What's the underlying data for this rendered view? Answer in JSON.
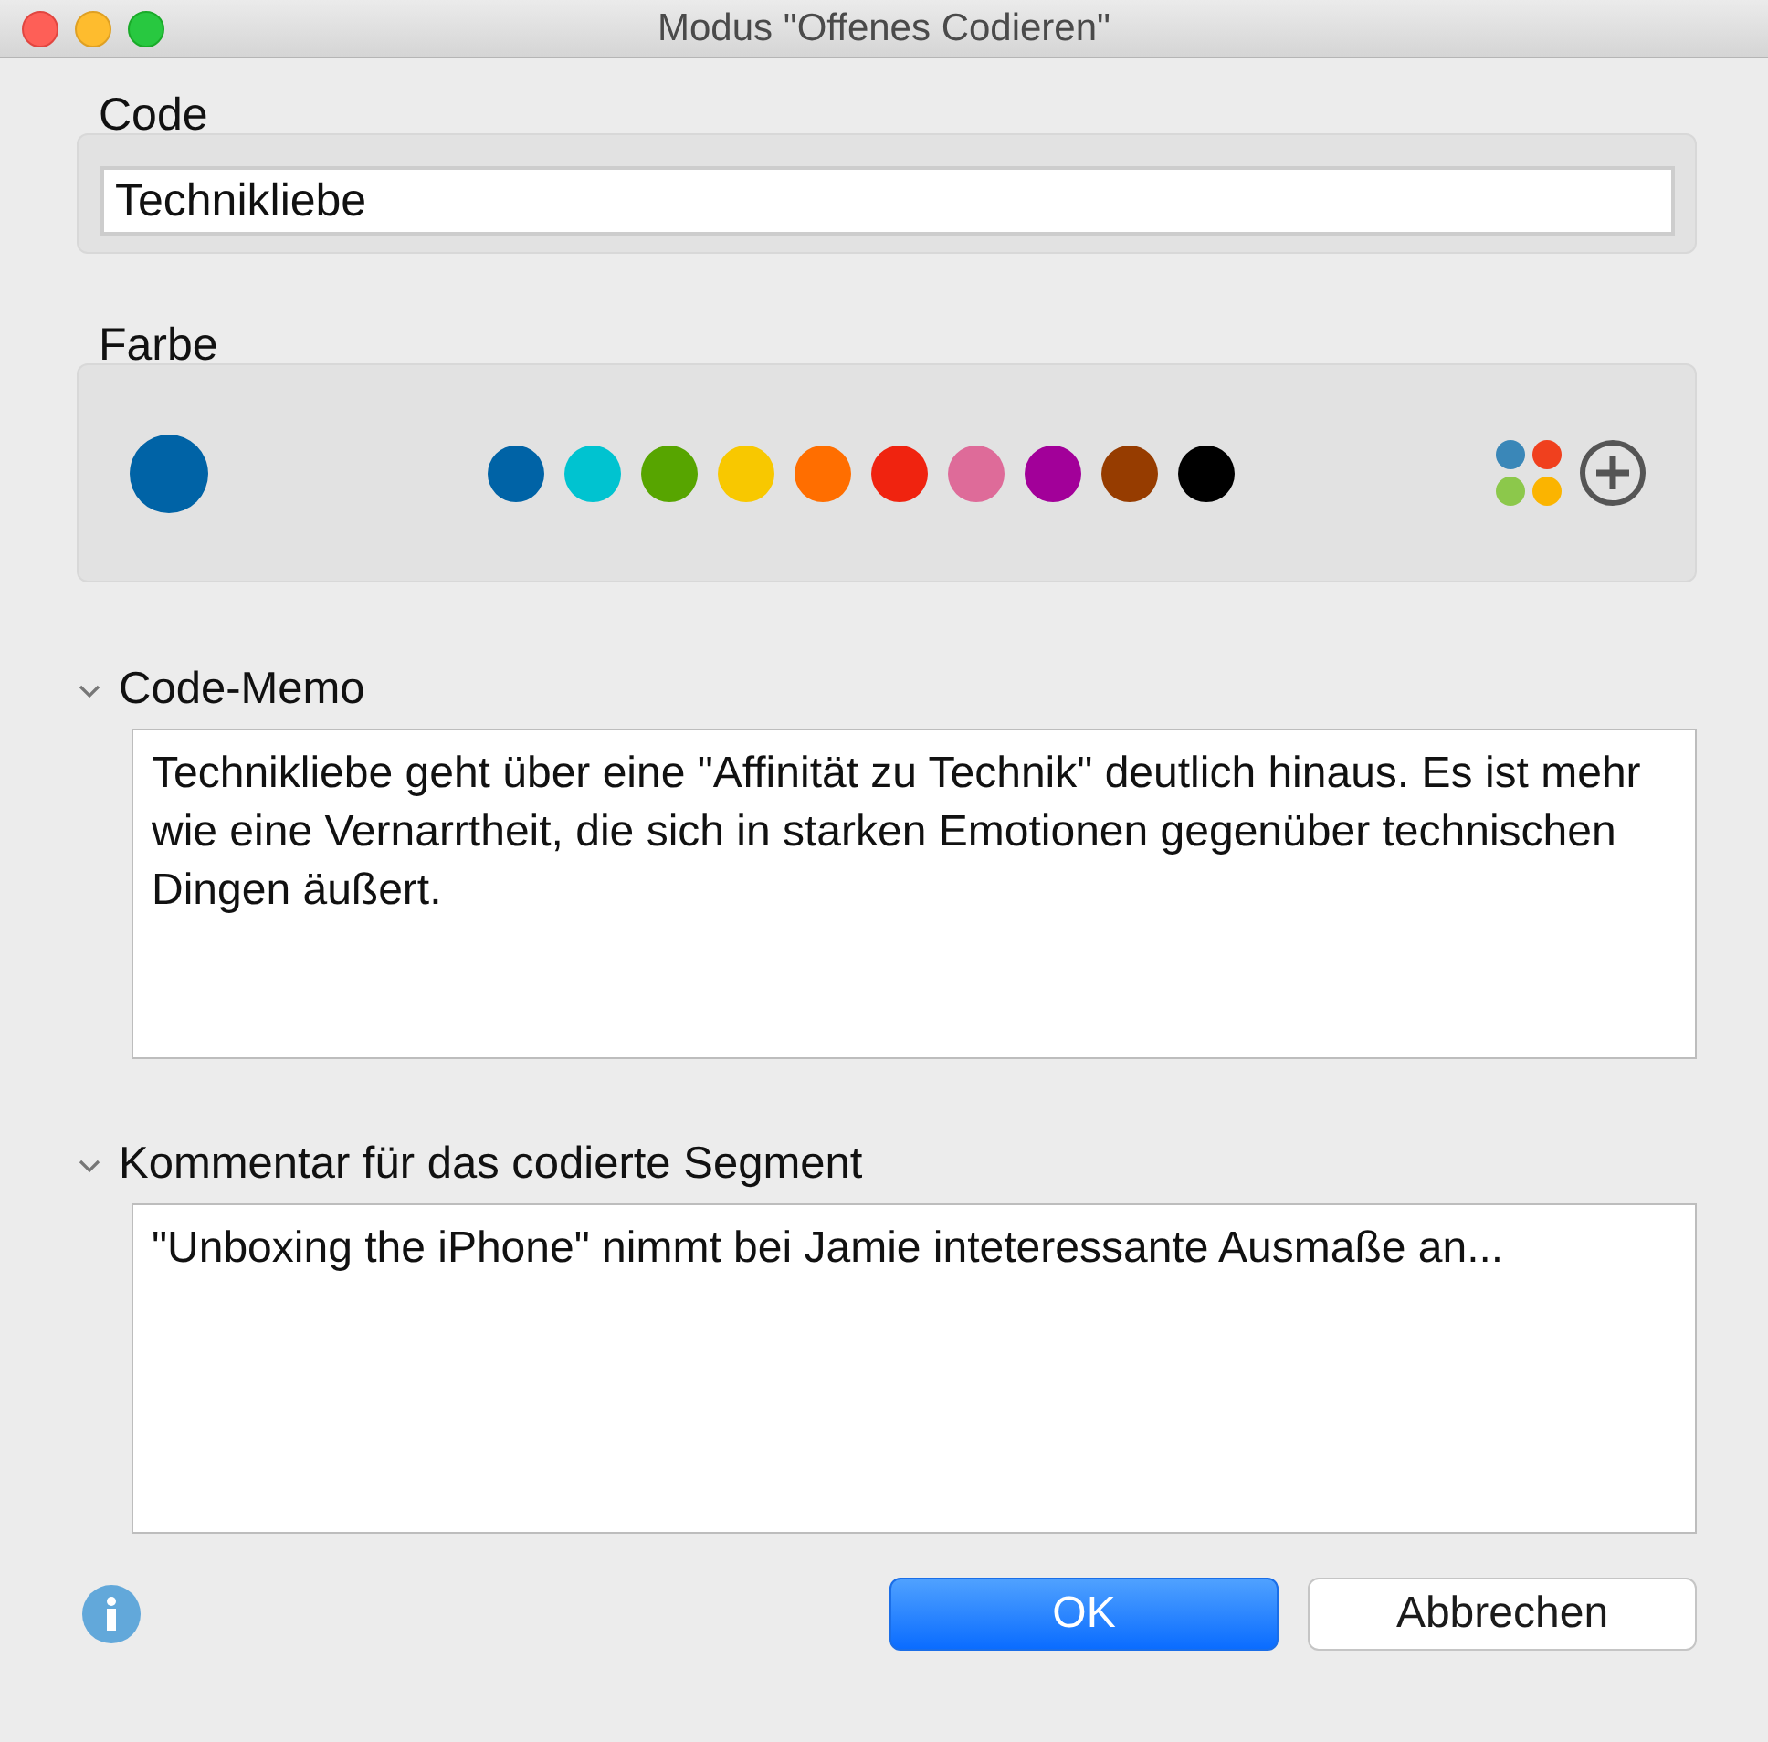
{
  "window": {
    "title": "Modus \"Offenes Codieren\""
  },
  "code": {
    "label": "Code",
    "value": "Technikliebe"
  },
  "farbe": {
    "label": "Farbe",
    "current": {
      "color": "#0063a6"
    },
    "swatches": [
      {
        "color": "#0063a6"
      },
      {
        "color": "#00c3d0"
      },
      {
        "color": "#57a500"
      },
      {
        "color": "#f8c800"
      },
      {
        "color": "#ff6e00"
      },
      {
        "color": "#f0230f"
      },
      {
        "color": "#de6b99"
      },
      {
        "color": "#a20099"
      },
      {
        "color": "#963c00"
      },
      {
        "color": "#000000"
      }
    ]
  },
  "sections": [
    {
      "title": "Code-Memo",
      "expanded": true,
      "text": "Technikliebe geht über eine \"Affinität zu Technik\" deutlich hinaus. Es ist mehr wie eine Vernarrtheit, die sich in starken Emotionen gegenüber technischen Dingen äußert."
    },
    {
      "title": "Kommentar für das codierte Segment",
      "expanded": true,
      "text": "\"Unboxing the iPhone\" nimmt bei Jamie inteteressante Ausmaße an..."
    }
  ],
  "buttons": [
    {
      "label": "OK",
      "kind": "primary"
    },
    {
      "label": "Abbrechen",
      "kind": "secondary"
    }
  ]
}
